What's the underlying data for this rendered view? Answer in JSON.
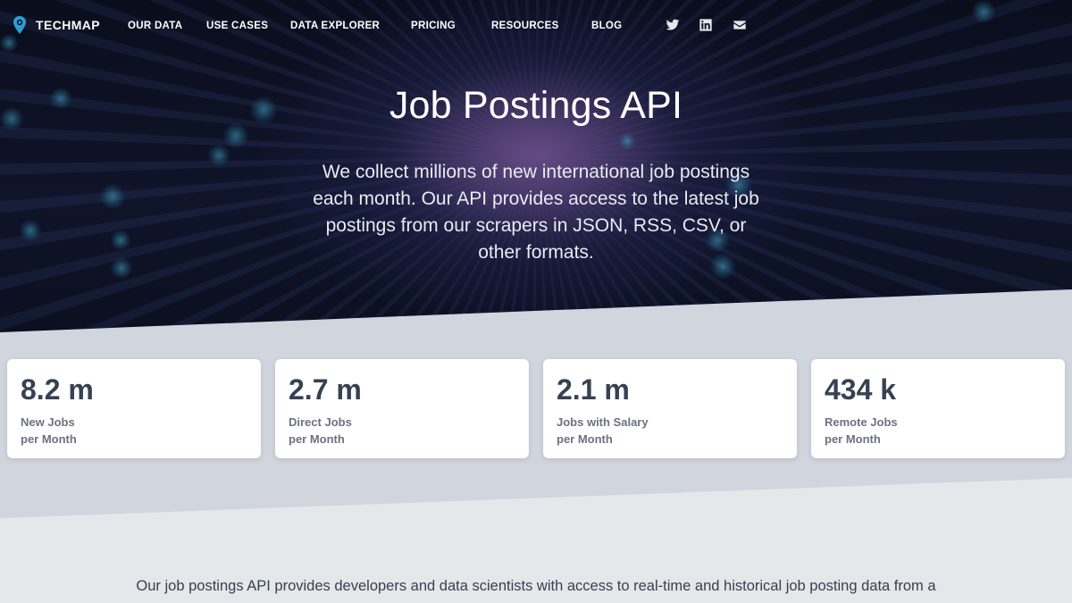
{
  "nav": {
    "brand": "TECHMAP",
    "items": [
      {
        "label": "OUR DATA"
      },
      {
        "label": "USE CASES"
      },
      {
        "label": "DATA EXPLORER"
      },
      {
        "label": "PRICING"
      },
      {
        "label": "RESOURCES"
      },
      {
        "label": "BLOG"
      }
    ],
    "social": [
      "twitter-icon",
      "linkedin-icon",
      "mail-icon"
    ]
  },
  "hero": {
    "title": "Job Postings API",
    "subtitle": "We collect millions of new international job postings each month. Our API provides access to the latest job postings from our scrapers in JSON, RSS, CSV, or other formats."
  },
  "stats": [
    {
      "value": "8.2 m",
      "label_line1": "New Jobs",
      "label_line2": "per Month"
    },
    {
      "value": "2.7 m",
      "label_line1": "Direct Jobs",
      "label_line2": "per Month"
    },
    {
      "value": "2.1 m",
      "label_line1": "Jobs with Salary",
      "label_line2": "per Month"
    },
    {
      "value": "434 k",
      "label_line1": "Remote Jobs",
      "label_line2": "per Month"
    }
  ],
  "body": {
    "intro": "Our job postings API provides developers and data scientists with access to real-time and historical job posting data from a"
  },
  "colors": {
    "hero_bg": "#0a0d1c",
    "accent": "#2a9fd6",
    "stat_value": "#374151",
    "stat_label": "#6b7280"
  }
}
